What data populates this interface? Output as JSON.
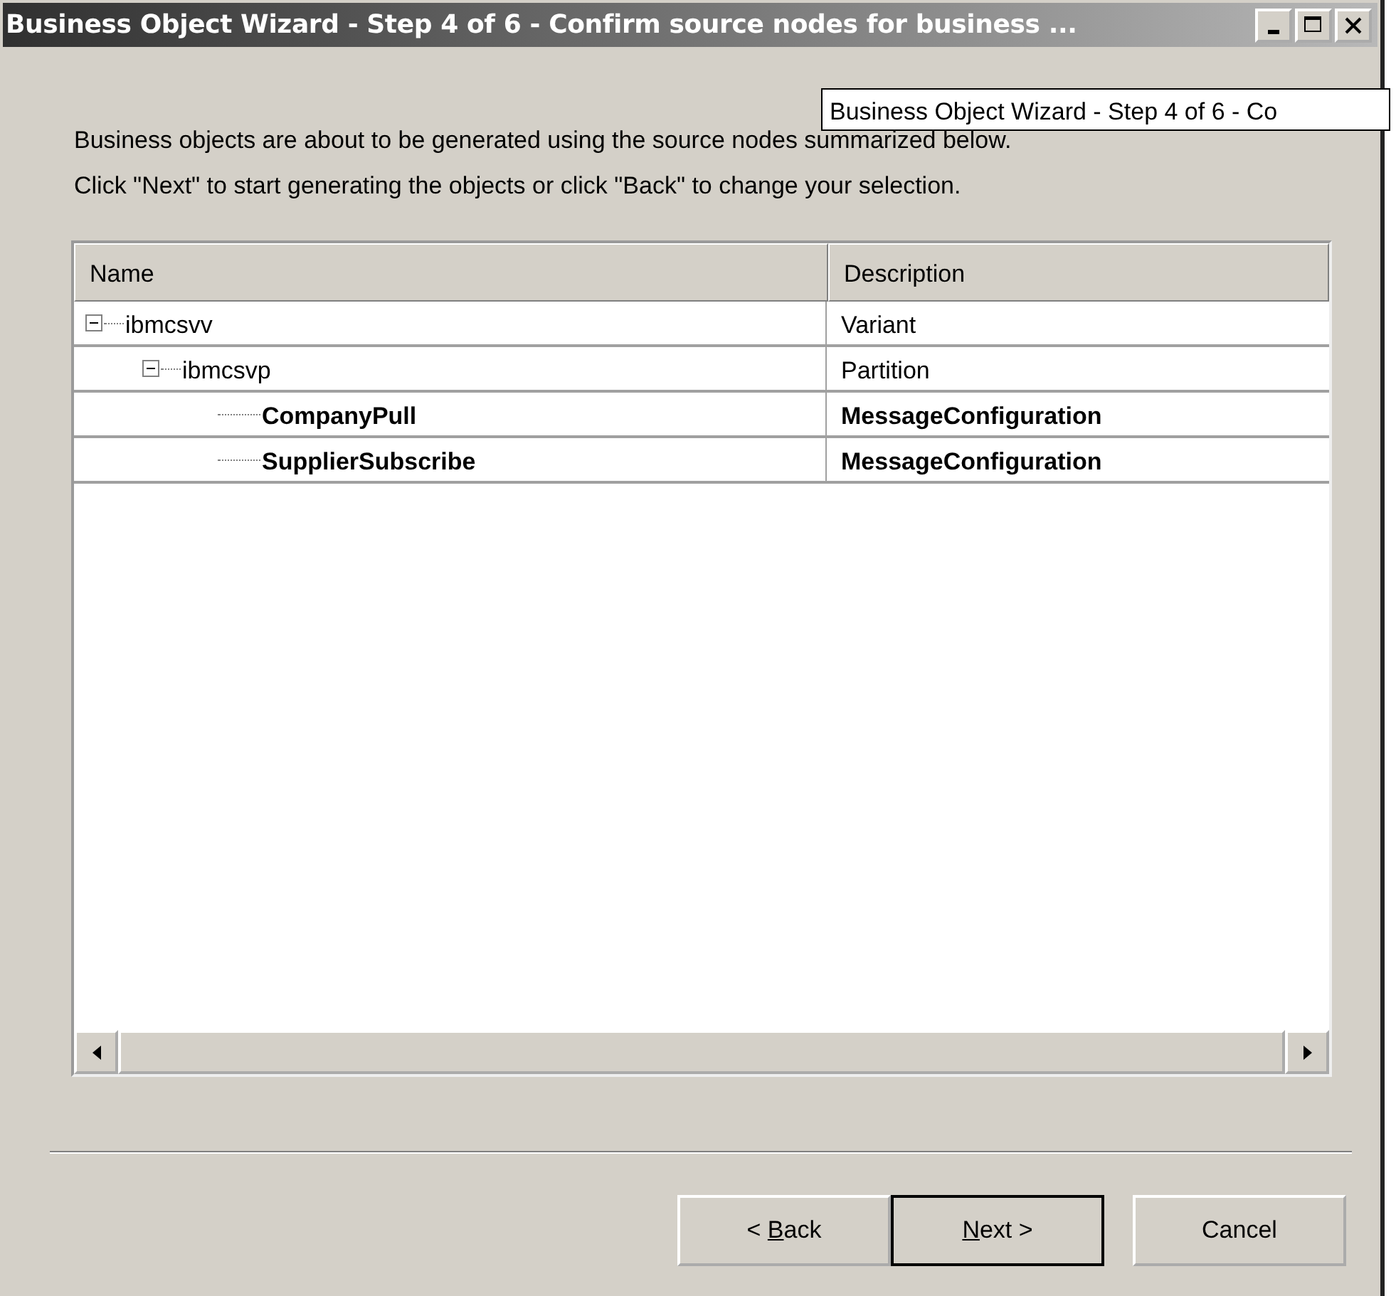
{
  "window": {
    "title": "Business Object Wizard - Step 4 of 6 - Confirm source nodes for business ..."
  },
  "tooltip": "Business Object Wizard - Step 4 of 6 - Co",
  "instructions": [
    "Business objects are about to be generated using the source nodes summarized below.",
    "Click \"Next\" to start generating the objects or click \"Back\" to change your selection."
  ],
  "table": {
    "columns": [
      "Name",
      "Description"
    ],
    "rows": [
      {
        "name": "ibmcsvv",
        "description": "Variant",
        "kind": "node",
        "expanded": true,
        "children": [
          {
            "name": "ibmcsvp",
            "description": "Partition",
            "kind": "node",
            "expanded": true,
            "children": [
              {
                "name": "CompanyPull",
                "description": "MessageConfiguration",
                "kind": "business_object"
              },
              {
                "name": "SupplierSubscribe",
                "description": "MessageConfiguration",
                "kind": "business_object"
              }
            ]
          }
        ]
      }
    ]
  },
  "buttons": [
    {
      "before": "< ",
      "key": "B",
      "after": "ack",
      "default": false
    },
    {
      "key": "N",
      "after": "ext >",
      "default": true
    },
    {
      "before": "Cancel",
      "default": false
    }
  ]
}
